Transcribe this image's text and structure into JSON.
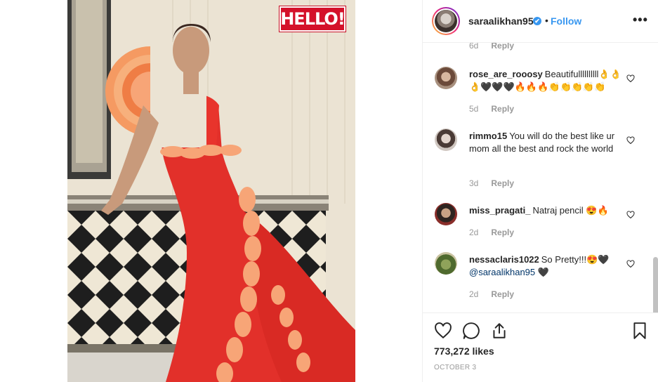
{
  "post": {
    "magazine_logo": "HELLO!",
    "author": {
      "username": "saraalikhan95",
      "verified_mark": "✔",
      "separator": "•",
      "follow_label": "Follow",
      "more_icon": "more-options-icon",
      "more_glyph": "•••"
    },
    "partial_comment": {
      "age": "6d",
      "reply_label": "Reply"
    },
    "comments": [
      {
        "username": "rose_are_rooosy",
        "text": "Beautifullllllllll👌👌👌🖤🖤🖤🔥🔥🔥👏👏👏👏👏",
        "age": "5d",
        "reply_label": "Reply"
      },
      {
        "username": "rimmo15",
        "text": "You will do the best like ur mom all the best and rock the world",
        "age": "3d",
        "reply_label": "Reply"
      },
      {
        "username": "miss_pragati_",
        "text": "Natraj pencil 😍🔥",
        "age": "2d",
        "reply_label": "Reply"
      },
      {
        "username": "nessaclaris1022",
        "text": "So Pretty!!!😍🖤",
        "mention": "@saraalikhan95",
        "text_after": " 🖤",
        "age": "2d",
        "reply_label": "Reply"
      }
    ],
    "likes_count": "773,272 likes",
    "date": "OCTOBER 3",
    "colors": {
      "link_blue": "#3897f0",
      "meta_gray": "#999999",
      "dress_red": "#e2302a",
      "ruffle_peach": "#f7a577",
      "logo_red": "#d4112a"
    }
  }
}
